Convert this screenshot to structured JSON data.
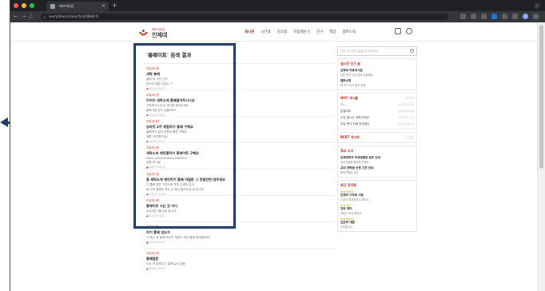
{
  "browser": {
    "tab_title": "에브리타임",
    "url": "everytime.kr/search/all/흉배이트",
    "tab_close": "×",
    "new_tab": "+",
    "nav_back": "←",
    "nav_forward": "→",
    "nav_reload": "C"
  },
  "site": {
    "logo_sub": "에브리타임",
    "logo_name": "인제대",
    "nav": [
      "게시판",
      "시간표",
      "강의실",
      "학점계산기",
      "친구",
      "책방",
      "캠퍼스픽"
    ]
  },
  "results": {
    "title": "'흉배이트' 검색 결과",
    "items": [
      {
        "board": "자유게시판",
        "title": "세탁 봉배",
        "body": "끝에 세 그렌 근처",
        "body2": "이거서 예쁜 신입도 ㅋ",
        "meta": "03/24 09:12"
      },
      {
        "board": "자유게시판",
        "title": "이거이 세탁소에 흉배달아주시나요",
        "body": "근처에 아시는분 계시면 알려주세요",
        "body2": "흉배 파는곳도 있을까요?",
        "meta": "03/21 14:05"
      },
      {
        "board": "자유게시판",
        "title": "승마킷 2주 체험하기 흉배 구해요",
        "body": "흉배하기 없이 전원이 빠른 구해요",
        "body2": "생협 30만원 이상",
        "meta": "03/18 10:41"
      },
      {
        "board": "자유게시판",
        "title": "세탁소에 재킷흉하기 흉배이트 구해요",
        "body": "https://everytime.kr/389102",
        "body2": "인원 제 6일",
        "meta": "03/15 08:22"
      },
      {
        "board": "자유게시판",
        "title": "흉 세탁소에 재킷하기 흉배 이질문 그 정말안한 대주세요",
        "body": "그 흉배 좋은 가격으로 우리 주세요 감사",
        "body2": "혹 근처 흉배도 하는 곳 혹시 알려주실 분 있나요",
        "meta": "03/12 19:30"
      },
      {
        "board": "자유게시판",
        "title": "흉배이트 사는 것 어디",
        "body": "2023년 4월 3일 입니다",
        "body2": "",
        "meta": "03/10 11:02"
      },
      {
        "board": "자유게시판",
        "title": "자기 흉배 있는지",
        "body": "그 혹시 흉 흉배 메시지 세탁소 재킷 흉배 해야할까요?",
        "body2": "",
        "meta": "03/08 16:44"
      },
      {
        "board": "자유게시판",
        "title": "흉배질문",
        "body": "너무 안 알려주기 흉배 실수 없음",
        "body2": "",
        "meta": "03/05 09:18"
      }
    ],
    "vote_icon": "▲",
    "comment_icon": "●"
  },
  "sidebar": {
    "search_placeholder": "전체 게시판의 글을 검색하세요!",
    "cards": [
      {
        "head": "실시간 인기 글",
        "more": "",
        "items": [
          {
            "t": "인제대 자유게시판",
            "b": "이번 학기 수업 정보 공유해요"
          },
          {
            "t": "캠퍼스픽",
            "b": "봄 학기 인기 행사 모음"
          }
        ]
      },
      {
        "head": "HOT 게시물",
        "more": "더 보기",
        "lines": [
          {
            "t": "ㅋ....",
            "d": "03/24 12:03"
          },
          {
            "t": "존잘러도",
            "d": "03/23 18:44"
          },
          {
            "t": "수업 끝나고 개피곤하네",
            "d": "03/23 11:20"
          },
          {
            "t": "오늘 학식 진짜 맛있었다",
            "d": "03/22 09:15"
          }
        ]
      },
      {
        "head": "BEST 게시판",
        "more": "더 보기",
        "items": []
      },
      {
        "head": "학교 소식",
        "more": "",
        "items": [
          {
            "t": "인제대학교 학생생활관 입주 안내",
            "b": "공지사항을 확인해 주세요"
          },
          {
            "t": "교내 장학금 신청 기간 안내",
            "b": "학생지원팀 공지"
          }
        ]
      },
      {
        "head": "최근 강의평",
        "more": "",
        "reviews": [
          {
            "stars": "★★★★★",
            "t": "인체의 구조와 기능",
            "b": "수업이 체계적이고 좋아요"
          },
          {
            "stars": "★★★★☆",
            "t": "교양 영어",
            "b": "과제가 조금 많아요"
          },
          {
            "stars": "★★★★★",
            "t": "간호학 개론",
            "b": "추천합니다"
          }
        ]
      }
    ]
  },
  "colors": {
    "accent": "#c62917",
    "highlight": "#1f3b66"
  }
}
